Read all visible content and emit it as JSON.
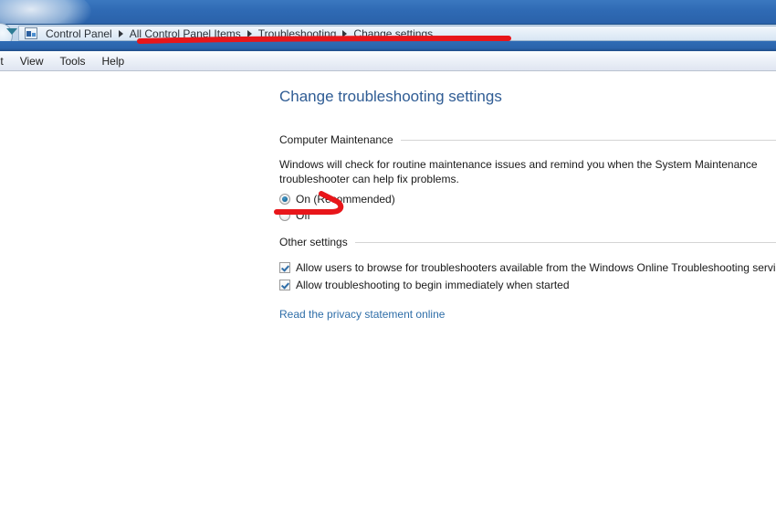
{
  "window": {
    "nav": {
      "back_icon": "back-circle-icon",
      "dropdown_icon": "chevron-down-icon",
      "address_icon": "control-panel-icon"
    },
    "breadcrumb": {
      "items": [
        {
          "label": "Control Panel"
        },
        {
          "label": "All Control Panel Items"
        },
        {
          "label": "Troubleshooting"
        },
        {
          "label": "Change settings"
        }
      ]
    },
    "menubar": {
      "items": [
        {
          "label": "dit",
          "full_label": "Edit",
          "clipped": true
        },
        {
          "label": "View",
          "clipped": false
        },
        {
          "label": "Tools",
          "clipped": false
        },
        {
          "label": "Help",
          "clipped": false
        }
      ]
    }
  },
  "content": {
    "page_title": "Change troubleshooting settings",
    "sections": [
      {
        "heading": "Computer Maintenance",
        "description": "Windows will check for routine maintenance issues and remind you when the System Maintenance troubleshooter can help fix problems.",
        "radios": [
          {
            "label": "On (Recommended)",
            "checked": true
          },
          {
            "label": "Off",
            "checked": false
          }
        ]
      },
      {
        "heading": "Other settings",
        "checkboxes": [
          {
            "label": "Allow users to browse for troubleshooters available from the Windows Online Troubleshooting service",
            "checked": true
          },
          {
            "label": "Allow troubleshooting to begin immediately when started",
            "checked": true
          }
        ]
      }
    ],
    "privacy_link": "Read the privacy statement online"
  },
  "annotations": {
    "color": "#e8161a",
    "marks": [
      {
        "name": "breadcrumb-underline",
        "shape": "horizontal-stroke"
      },
      {
        "name": "off-option-arrow",
        "shape": "hooked-arrow"
      }
    ]
  },
  "colors": {
    "frame_blue": "#2f6ab4",
    "title_text": "#2f5c94",
    "link": "#2f6ea8",
    "annotation_red": "#e8161a"
  }
}
